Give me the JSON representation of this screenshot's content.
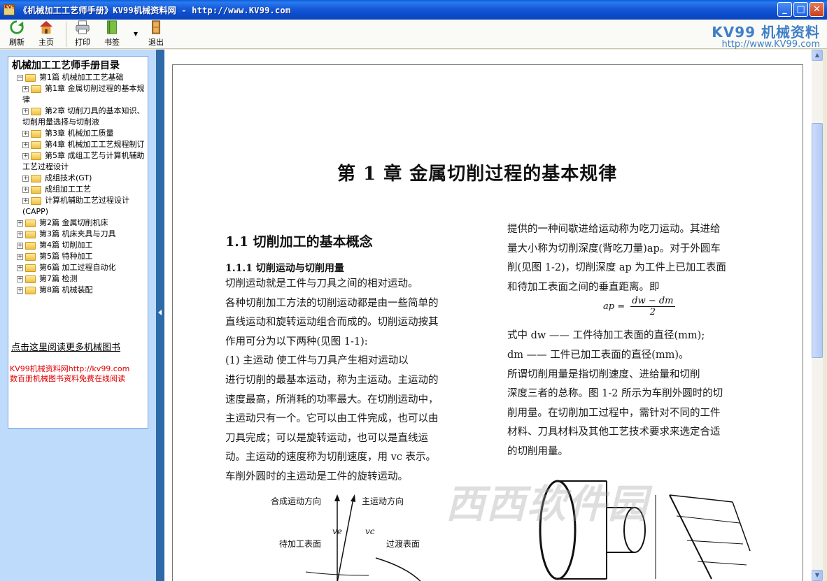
{
  "window": {
    "title": "《机械加工工艺师手册》KV99机械资料网 - http://www.KV99.com",
    "icon_text": "KV99",
    "controls": [
      "minimize",
      "maximize",
      "close"
    ]
  },
  "toolbar": {
    "refresh": "刷新",
    "home": "主页",
    "print": "打印",
    "bookmark": "书签",
    "exit": "退出",
    "brand_name": "KV99 机械资料",
    "brand_url": "http://www.KV99.com"
  },
  "toc": {
    "title": "机械加工工艺师手册目录",
    "items": [
      {
        "level": 0,
        "expanded": true,
        "label": "第1篇  机械加工工艺基础",
        "open": true
      },
      {
        "level": 1,
        "label": "第1章  金属切削过程的基本规律"
      },
      {
        "level": 1,
        "label": "第2章  切削刀具的基本知识、切削用量选择与切削液"
      },
      {
        "level": 1,
        "label": "第3章  机械加工质量"
      },
      {
        "level": 1,
        "label": "第4章  机械加工工艺规程制订"
      },
      {
        "level": 1,
        "label": "第5章  成组工艺与计算机辅助工艺过程设计"
      },
      {
        "level": 1,
        "label": "成组技术(GT)"
      },
      {
        "level": 1,
        "label": "成组加工工艺"
      },
      {
        "level": 1,
        "label": "计算机辅助工艺过程设计(CAPP)"
      },
      {
        "level": 0,
        "label": "第2篇  金属切削机床"
      },
      {
        "level": 0,
        "label": "第3篇  机床夹具与刀具"
      },
      {
        "level": 0,
        "label": "第4篇  切削加工"
      },
      {
        "level": 0,
        "label": "第5篇  特种加工"
      },
      {
        "level": 0,
        "label": "第6篇  加工过程自动化"
      },
      {
        "level": 0,
        "label": "第7篇  检测"
      },
      {
        "level": 0,
        "label": "第8篇  机械装配"
      }
    ],
    "more_link": "点击这里阅读更多机械图书",
    "promo_line1": "KV99机械资料网http://kv99.com",
    "promo_line2": "数百册机械图书资料免费在线阅读"
  },
  "page": {
    "chapter_title": "第 1 章    金属切削过程的基本规律",
    "section_title": "1.1    切削加工的基本概念",
    "subsection_title": "1.1.1    切削运动与切削用量",
    "left_lines": [
      "      切削运动就是工件与刀具之间的相对运动。",
      "各种切削加工方法的切削运动都是由一些简单的",
      "直线运动和旋转运动组合而成的。切削运动按其",
      "作用可分为以下两种(见图 1-1):",
      "      (1) 主运动    使工件与刀具产生相对运动以",
      "进行切削的最基本运动，称为主运动。主运动的",
      "速度最高，所消耗的功率最大。在切削运动中，",
      "主运动只有一个。它可以由工件完成，也可以由",
      "刀具完成；可以是旋转运动，也可以是直线运",
      "动。主运动的速度称为切削速度，用 vc 表示。",
      "车削外圆时的主运动是工件的旋转运动。"
    ],
    "right_lines": [
      "提供的一种间歇进给运动称为吃刀运动。其进给",
      "量大小称为切削深度(背吃刀量)ap。对于外圆车",
      "削(见图 1-2)，切削深度 ap 为工件上已加工表面",
      "和待加工表面之间的垂直距离。即"
    ],
    "formula_lhs": "ap =",
    "formula_num": "dw − dm",
    "formula_den": "2",
    "right_lines_2": [
      "式中    dw —— 工件待加工表面的直径(mm);",
      "            dm —— 工件已加工表面的直径(mm)。",
      "      所谓切削用量是指切削速度、进给量和切削",
      "深度三者的总称。图 1-2 所示为车削外圆时的切",
      "削用量。在切削加工过程中，需针对不同的工件",
      "材料、刀具材料及其他工艺技术要求来选定合适",
      "的切削用量。"
    ],
    "fig_labels": {
      "combined": "合成运动方向",
      "main": "主运动方向",
      "ve": "ve",
      "vc": "vc",
      "to_machine": "待加工表面",
      "transition": "过渡表面"
    },
    "watermark": "西西软件园"
  },
  "colors": {
    "titlebar": "#0a49c9",
    "leftpane": "#bfdbfc",
    "splitter": "#2d6aa8",
    "brand": "#3f7fc8",
    "promo": "#e00000"
  }
}
